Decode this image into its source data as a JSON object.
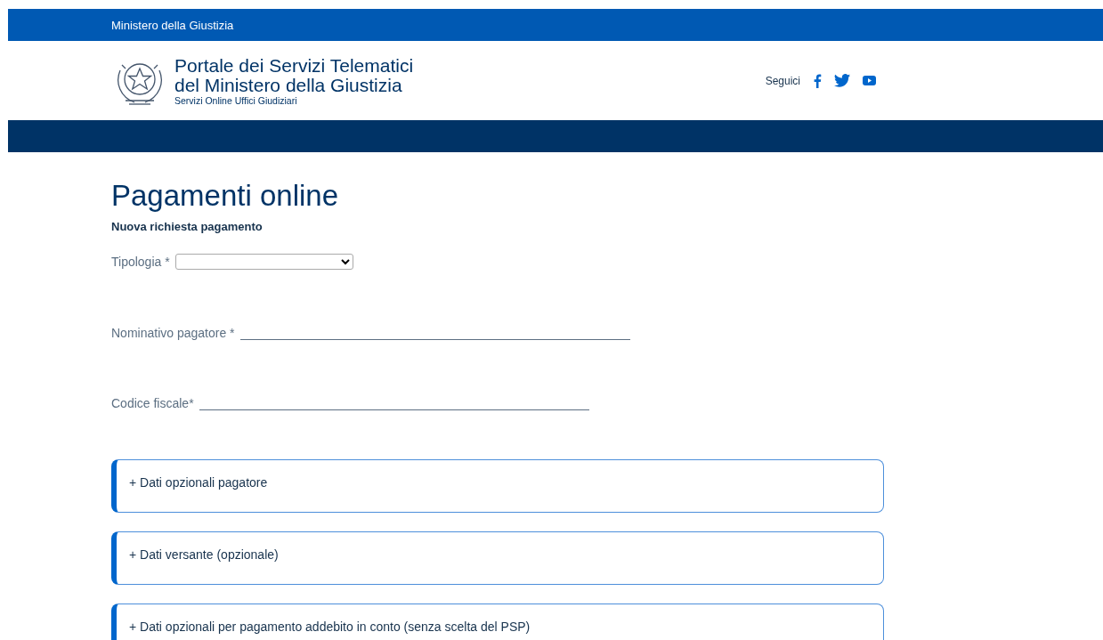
{
  "top_bar": {
    "title": "Ministero della Giustizia"
  },
  "header": {
    "title_line_1": "Portale dei Servizi Telematici",
    "title_line_2": "del Ministero della Giustizia",
    "subtitle": "Servizi Online Uffici Giudiziari",
    "follow_label": "Seguici",
    "social": [
      {
        "kind": "facebook"
      },
      {
        "kind": "twitter"
      },
      {
        "kind": "youtube"
      }
    ]
  },
  "page": {
    "title": "Pagamenti online",
    "subtitle": "Nuova richiesta pagamento"
  },
  "form": {
    "fields": [
      {
        "kind": "select",
        "label": "Tipologia *"
      },
      {
        "kind": "text",
        "label": "Nominativo pagatore *"
      },
      {
        "kind": "text",
        "label": "Codice fiscale*"
      }
    ]
  },
  "panels": [
    {
      "title": "+ Dati opzionali pagatore"
    },
    {
      "title": "+ Dati versante (opzionale)"
    },
    {
      "title": "+ Dati opzionali per pagamento addebito in conto (senza scelta del PSP)"
    }
  ]
}
